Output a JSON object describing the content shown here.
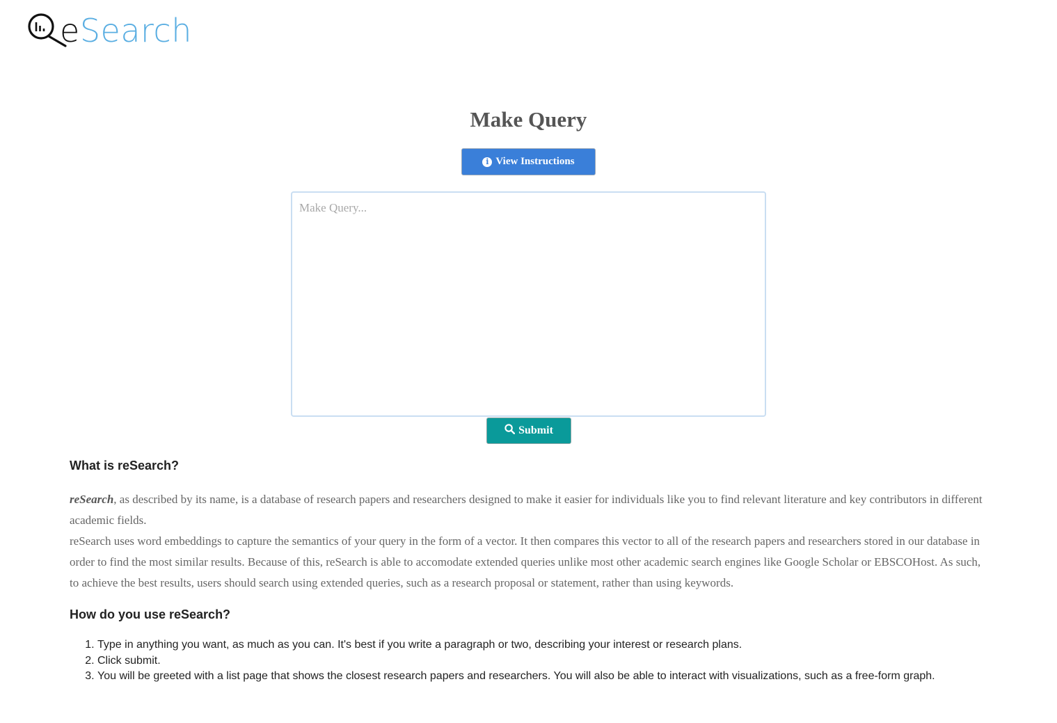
{
  "logo": {
    "text_e": "e",
    "text_rest": "Search",
    "brand_color": "#5aaee2"
  },
  "main": {
    "title": "Make Query",
    "instructions_button": "View Instructions",
    "query_placeholder": "Make Query...",
    "query_value": "",
    "submit_button": "Submit",
    "accent_blue": "#3a7fd9",
    "accent_teal": "#0a9a9a"
  },
  "about": {
    "heading": "What is reSearch?",
    "brand_italic": "reSearch",
    "paragraph1_rest": ", as described by its name, is a database of research papers and researchers designed to make it easier for individuals like you to find relevant literature and key contributors in different academic fields.",
    "paragraph2": "reSearch uses word embeddings to capture the semantics of your query in the form of a vector. It then compares this vector to all of the research papers and researchers stored in our database in order to find the most similar results. Because of this, reSearch is able to accomodate extended queries unlike most other academic search engines like Google Scholar or EBSCOHost. As such, to achieve the best results, users should search using extended queries, such as a research proposal or statement, rather than using keywords."
  },
  "howto": {
    "heading": "How do you use reSearch?",
    "steps": [
      "Type in anything you want, as much as you can. It's best if you write a paragraph or two, describing your interest or research plans.",
      "Click submit.",
      "You will be greeted with a list page that shows the closest research papers and researchers. You will also be able to interact with visualizations, such as a free-form graph."
    ]
  },
  "icons": {
    "logo": "magnifier-chart-icon",
    "info": "info-circle-icon",
    "search": "search-icon"
  }
}
